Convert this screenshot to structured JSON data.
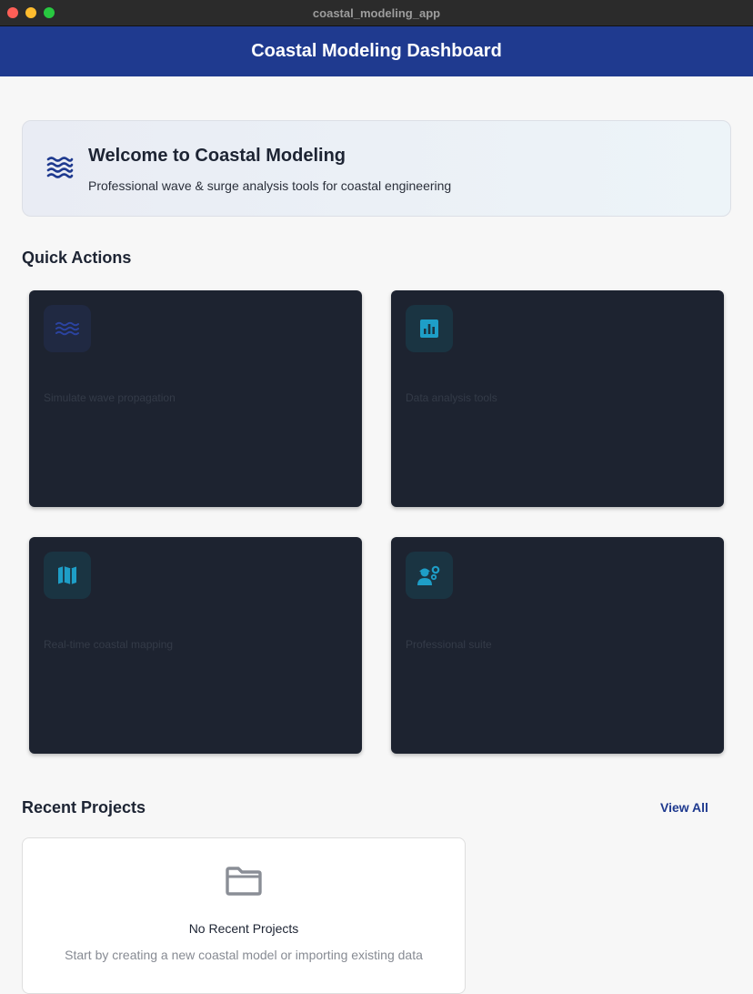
{
  "window": {
    "title": "coastal_modeling_app"
  },
  "appbar": {
    "title": "Coastal Modeling Dashboard"
  },
  "welcome": {
    "title": "Welcome to Coastal Modeling",
    "subtitle": "Professional wave & surge analysis tools for coastal engineering",
    "icon": "waves-icon"
  },
  "quick_actions": {
    "title": "Quick Actions",
    "items": [
      {
        "description": "Simulate wave propagation",
        "icon": "waves-icon"
      },
      {
        "description": "Data analysis tools",
        "icon": "analytics-icon"
      },
      {
        "description": "Real-time coastal mapping",
        "icon": "map-icon"
      },
      {
        "description": "Professional suite",
        "icon": "engineering-icon"
      }
    ]
  },
  "recent_projects": {
    "title": "Recent Projects",
    "view_all": "View All",
    "empty_title": "No Recent Projects",
    "empty_subtitle": "Start by creating a new coastal model or importing existing data",
    "icon": "folder-icon"
  },
  "colors": {
    "primary": "#1f3a8f",
    "card_bg": "#1d2330",
    "teal_accent": "#1e9ec7",
    "background": "#f7f7f7"
  }
}
